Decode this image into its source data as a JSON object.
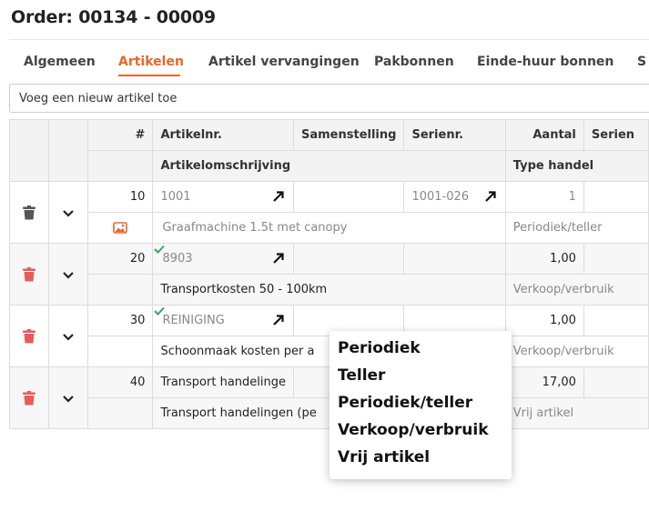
{
  "page": {
    "title": "Order: 00134 - 00009"
  },
  "tabs": [
    "Algemeen",
    "Artikelen",
    "Artikel vervangingen",
    "Pakbonnen",
    "Einde-huur bonnen",
    "S"
  ],
  "add_article": {
    "value": "Voeg een nieuw artikel toe"
  },
  "table": {
    "headers": {
      "nr": "#",
      "artikelnr": "Artikelnr.",
      "samenstelling": "Samenstelling",
      "serienr": "Serienr.",
      "aantal": "Aantal",
      "serien": "Serien",
      "omschrijving": "Artikelomschrijving",
      "type_handel": "Type handel"
    },
    "rows": [
      {
        "nr": "10",
        "artikelnr": "1001",
        "serienr": "1001-026",
        "aantal": "1",
        "omschrijving": "Graafmachine 1.5t met canopy",
        "type_handel": "Periodiek/teller"
      },
      {
        "nr": "20",
        "artikelnr": "8903",
        "serienr": "",
        "aantal": "1,00",
        "omschrijving": "Transportkosten 50 - 100km",
        "type_handel": "Verkoop/verbruik"
      },
      {
        "nr": "30",
        "artikelnr": "REINIGING",
        "serienr": "",
        "aantal": "1,00",
        "omschrijving": "Schoonmaak kosten per a",
        "type_handel": "Verkoop/verbruik"
      },
      {
        "nr": "40",
        "artikelnr": "Transport handelinge",
        "serienr": "",
        "aantal": "17,00",
        "omschrijving": "Transport handelingen (pe",
        "type_handel": "Vrij artikel"
      }
    ]
  },
  "dropdown": {
    "options": [
      "Periodiek",
      "Teller",
      "Periodiek/teller",
      "Verkoop/verbruik",
      "Vrij artikel"
    ]
  },
  "colors": {
    "accent": "#e8662a",
    "trash_active": "#e85b5b",
    "trash_disabled": "#555555",
    "check": "#3aa655"
  },
  "icons": {
    "delete": "trash-icon",
    "expand": "chevron-down-icon",
    "open": "arrow-up-right-icon",
    "image": "image-icon",
    "status": "check-icon"
  }
}
